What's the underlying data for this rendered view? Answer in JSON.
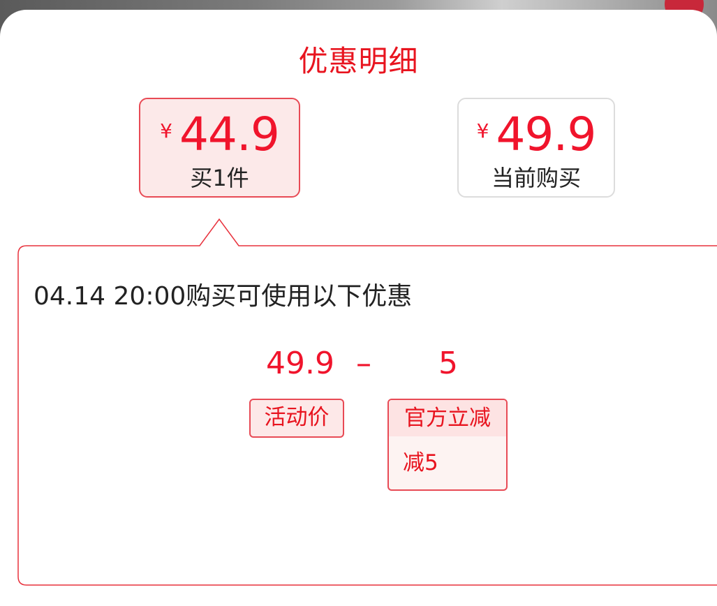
{
  "sheet": {
    "title": "优惠明细"
  },
  "options": [
    {
      "currency": "¥",
      "price": "44.9",
      "label": "买1件",
      "selected": true
    },
    {
      "currency": "¥",
      "price": "49.9",
      "label": "当前购买",
      "selected": false
    }
  ],
  "detail": {
    "condition": "04.14 20:00购买可使用以下优惠",
    "base_price": "49.9",
    "operator": "–",
    "discount_value": "5",
    "tags": {
      "activity_price": "活动价",
      "official_discount": "官方立减",
      "official_discount_detail": "减5"
    }
  },
  "colors": {
    "accent": "#f0142c",
    "border_accent": "#e84a55",
    "selected_bg": "#fce9e9"
  }
}
